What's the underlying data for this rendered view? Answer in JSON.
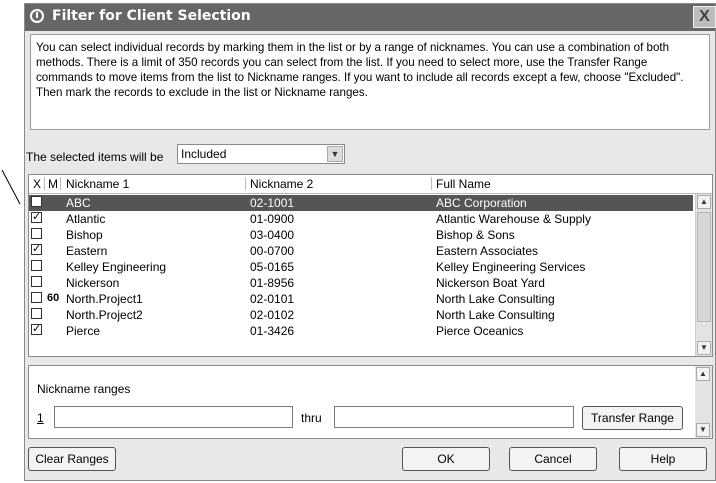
{
  "window": {
    "title": "Filter for Client Selection",
    "close_glyph": "X"
  },
  "info_text": "You can select individual records by marking them in the list or by a range of nicknames. You can use a combination of both methods. There is a limit of 350 records you can select from the list. If you need to select more, use the Transfer Range commands to move items from the list to Nickname ranges. If you want to include all records except a few, choose \"Excluded\". Then mark the records to exclude in the list or Nickname ranges.",
  "selection": {
    "label": "The selected items will be",
    "value": "Included"
  },
  "list": {
    "headers": {
      "x": "X",
      "m": "M",
      "nickname1": "Nickname 1",
      "nickname2": "Nickname 2",
      "fullname": "Full Name"
    },
    "rows": [
      {
        "checked": false,
        "mark": "",
        "nickname1": "ABC",
        "nickname2": "02-1001",
        "fullname": "ABC Corporation",
        "selected": true
      },
      {
        "checked": true,
        "mark": "",
        "nickname1": "Atlantic",
        "nickname2": "01-0900",
        "fullname": "Atlantic Warehouse & Supply",
        "selected": false
      },
      {
        "checked": false,
        "mark": "",
        "nickname1": "Bishop",
        "nickname2": "03-0400",
        "fullname": "Bishop & Sons",
        "selected": false
      },
      {
        "checked": true,
        "mark": "",
        "nickname1": "Eastern",
        "nickname2": "00-0700",
        "fullname": "Eastern Associates",
        "selected": false
      },
      {
        "checked": false,
        "mark": "",
        "nickname1": "Kelley Engineering",
        "nickname2": "05-0165",
        "fullname": "Kelley Engineering Services",
        "selected": false
      },
      {
        "checked": false,
        "mark": "",
        "nickname1": "Nickerson",
        "nickname2": "01-8956",
        "fullname": "Nickerson Boat Yard",
        "selected": false
      },
      {
        "checked": false,
        "mark": "60",
        "nickname1": "North.Project1",
        "nickname2": "02-0101",
        "fullname": "North Lake Consulting",
        "selected": false
      },
      {
        "checked": false,
        "mark": "",
        "nickname1": "North.Project2",
        "nickname2": "02-0102",
        "fullname": "North Lake Consulting",
        "selected": false
      },
      {
        "checked": true,
        "mark": "",
        "nickname1": "Pierce",
        "nickname2": "01-3426",
        "fullname": "Pierce Oceanics",
        "selected": false
      }
    ]
  },
  "ranges": {
    "label": "Nickname ranges",
    "index": "1",
    "thru_label": "thru",
    "from_value": "",
    "to_value": ""
  },
  "buttons": {
    "transfer": "Transfer Range",
    "clear": "Clear Ranges",
    "ok": "OK",
    "cancel": "Cancel",
    "help": "Help"
  },
  "icons": {
    "app": "clock-icon",
    "close": "close-icon",
    "dropdown": "chevron-down-icon",
    "scroll_up": "arrow-up-icon",
    "scroll_down": "arrow-down-icon",
    "check": "checkmark-icon"
  },
  "colors": {
    "titlebar": "#666666",
    "selected_row": "#555555",
    "dialog_bg": "#e8e8e8"
  }
}
